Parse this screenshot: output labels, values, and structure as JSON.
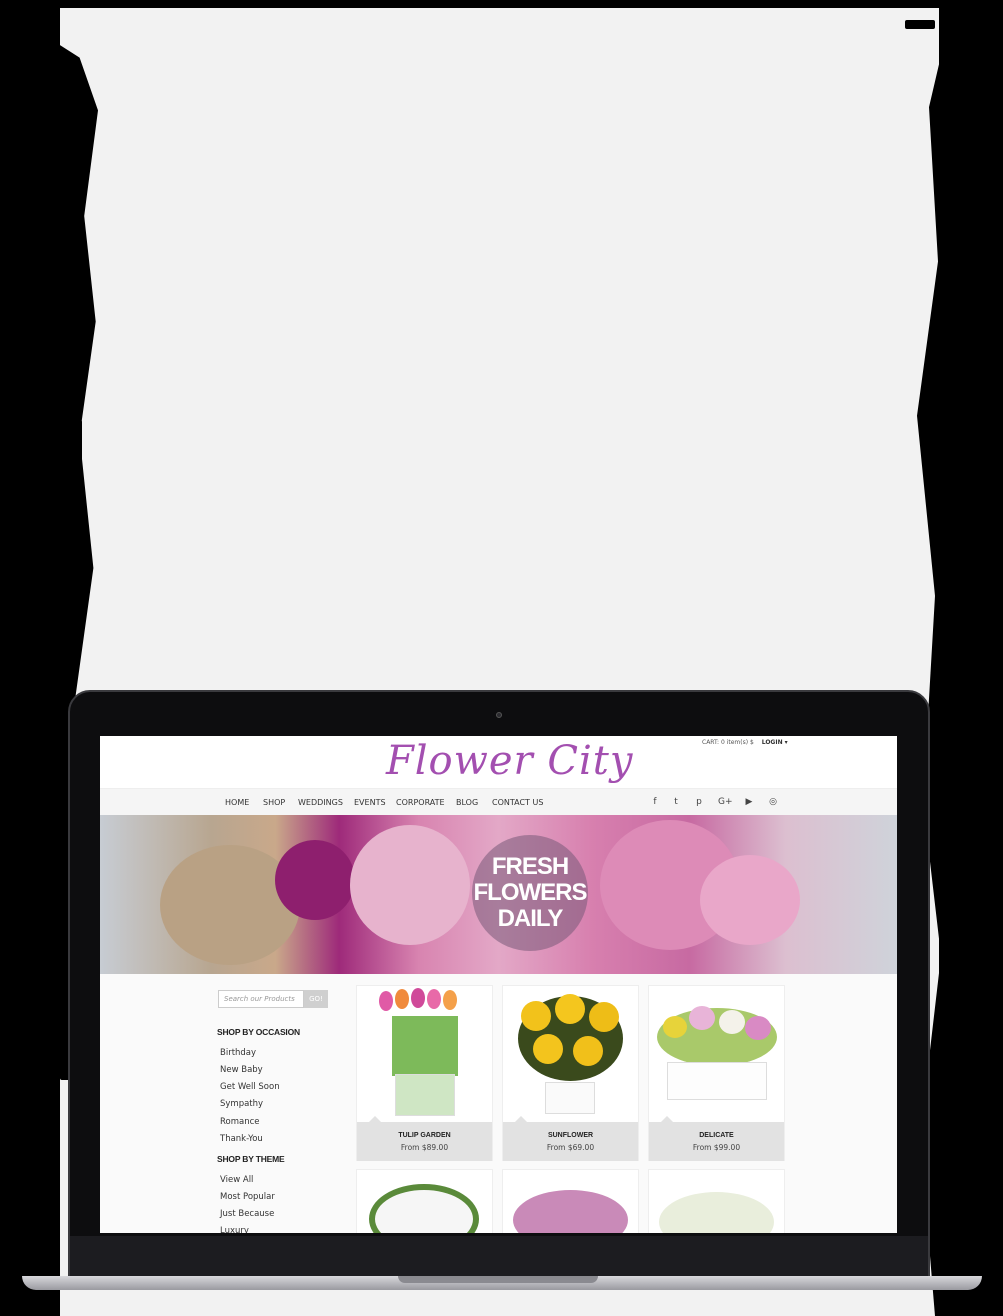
{
  "brand": {
    "name": "Flower City",
    "accent": "#a34fb0"
  },
  "header": {
    "cart": "CART: 0 item(s) $",
    "login": "LOGIN ▾"
  },
  "nav": {
    "items": [
      "HOME",
      "SHOP",
      "WEDDINGS",
      "EVENTS",
      "CORPORATE",
      "BLOG",
      "CONTACT US"
    ]
  },
  "social": {
    "icons": [
      "facebook-icon",
      "twitter-icon",
      "pinterest-icon",
      "google-plus-icon",
      "youtube-icon",
      "instagram-icon"
    ],
    "glyphs": [
      "f",
      "t",
      "p",
      "G+",
      "▶",
      "◎"
    ]
  },
  "hero": {
    "line1": "FRESH",
    "line2": "FLOWERS",
    "line3": "DAILY"
  },
  "search": {
    "placeholder": "Search our Products",
    "button": "GO!"
  },
  "sidebar": {
    "occasion_heading": "SHOP BY OCCASION",
    "occasion": [
      "Birthday",
      "New Baby",
      "Get Well Soon",
      "Sympathy",
      "Romance",
      "Thank-You"
    ],
    "theme_heading": "SHOP BY THEME",
    "theme": [
      "View All",
      "Most Popular",
      "Just Because",
      "Luxury"
    ]
  },
  "products": [
    {
      "name": "TULIP GARDEN",
      "price": "From $89.00"
    },
    {
      "name": "SUNFLOWER",
      "price": "From $69.00"
    },
    {
      "name": "DELICATE",
      "price": "From $99.00"
    }
  ]
}
